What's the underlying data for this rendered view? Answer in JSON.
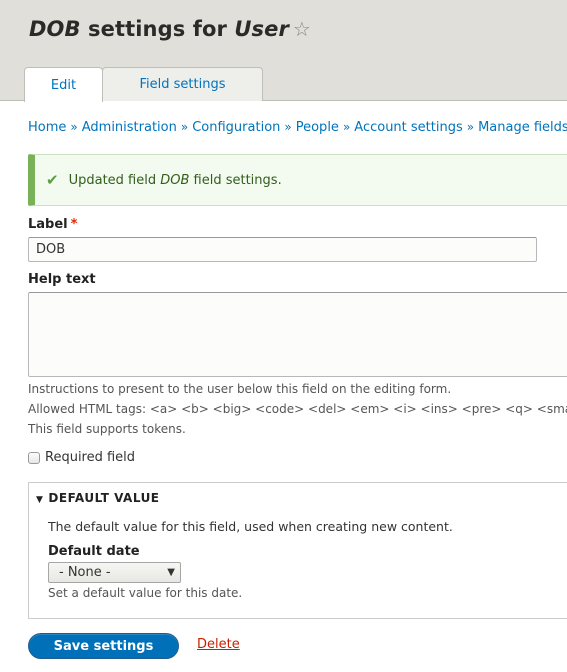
{
  "header": {
    "title_field": "DOB",
    "title_middle": " settings for ",
    "title_entity": "User",
    "star_icon": "☆"
  },
  "tabs": [
    {
      "label": "Edit",
      "active": true
    },
    {
      "label": "Field settings",
      "active": false
    }
  ],
  "breadcrumb": {
    "separator": "»",
    "items": [
      "Home",
      "Administration",
      "Configuration",
      "People",
      "Account settings",
      "Manage fields"
    ]
  },
  "message": {
    "icon": "check-icon",
    "prefix": "Updated field ",
    "field": "DOB",
    "suffix": " field settings."
  },
  "form": {
    "label_field": {
      "label": "Label",
      "required_marker": "*",
      "value": "DOB"
    },
    "help_text": {
      "label": "Help text",
      "value": "",
      "description_lines": [
        "Instructions to present to the user below this field on the editing form.",
        "Allowed HTML tags: <a> <b> <big> <code> <del> <em> <i> <ins> <pre> <q> <small> <span> <strong> <sub> <sup> <tt> <ol> <ul> <li> <p> <br> <img>",
        "This field supports tokens."
      ]
    },
    "required_checkbox": {
      "label": "Required field",
      "checked": false
    },
    "default_value": {
      "summary": "Default value",
      "expanded": true,
      "description": "The default value for this field, used when creating new content.",
      "date_label": "Default date",
      "date_selected": "- None -",
      "date_description": "Set a default value for this date."
    }
  },
  "actions": {
    "save_label": "Save settings",
    "delete_label": "Delete"
  },
  "colors": {
    "link": "#0074bd",
    "primary_button": "#0071b8",
    "success_border": "#77b259",
    "danger": "#c72100"
  }
}
